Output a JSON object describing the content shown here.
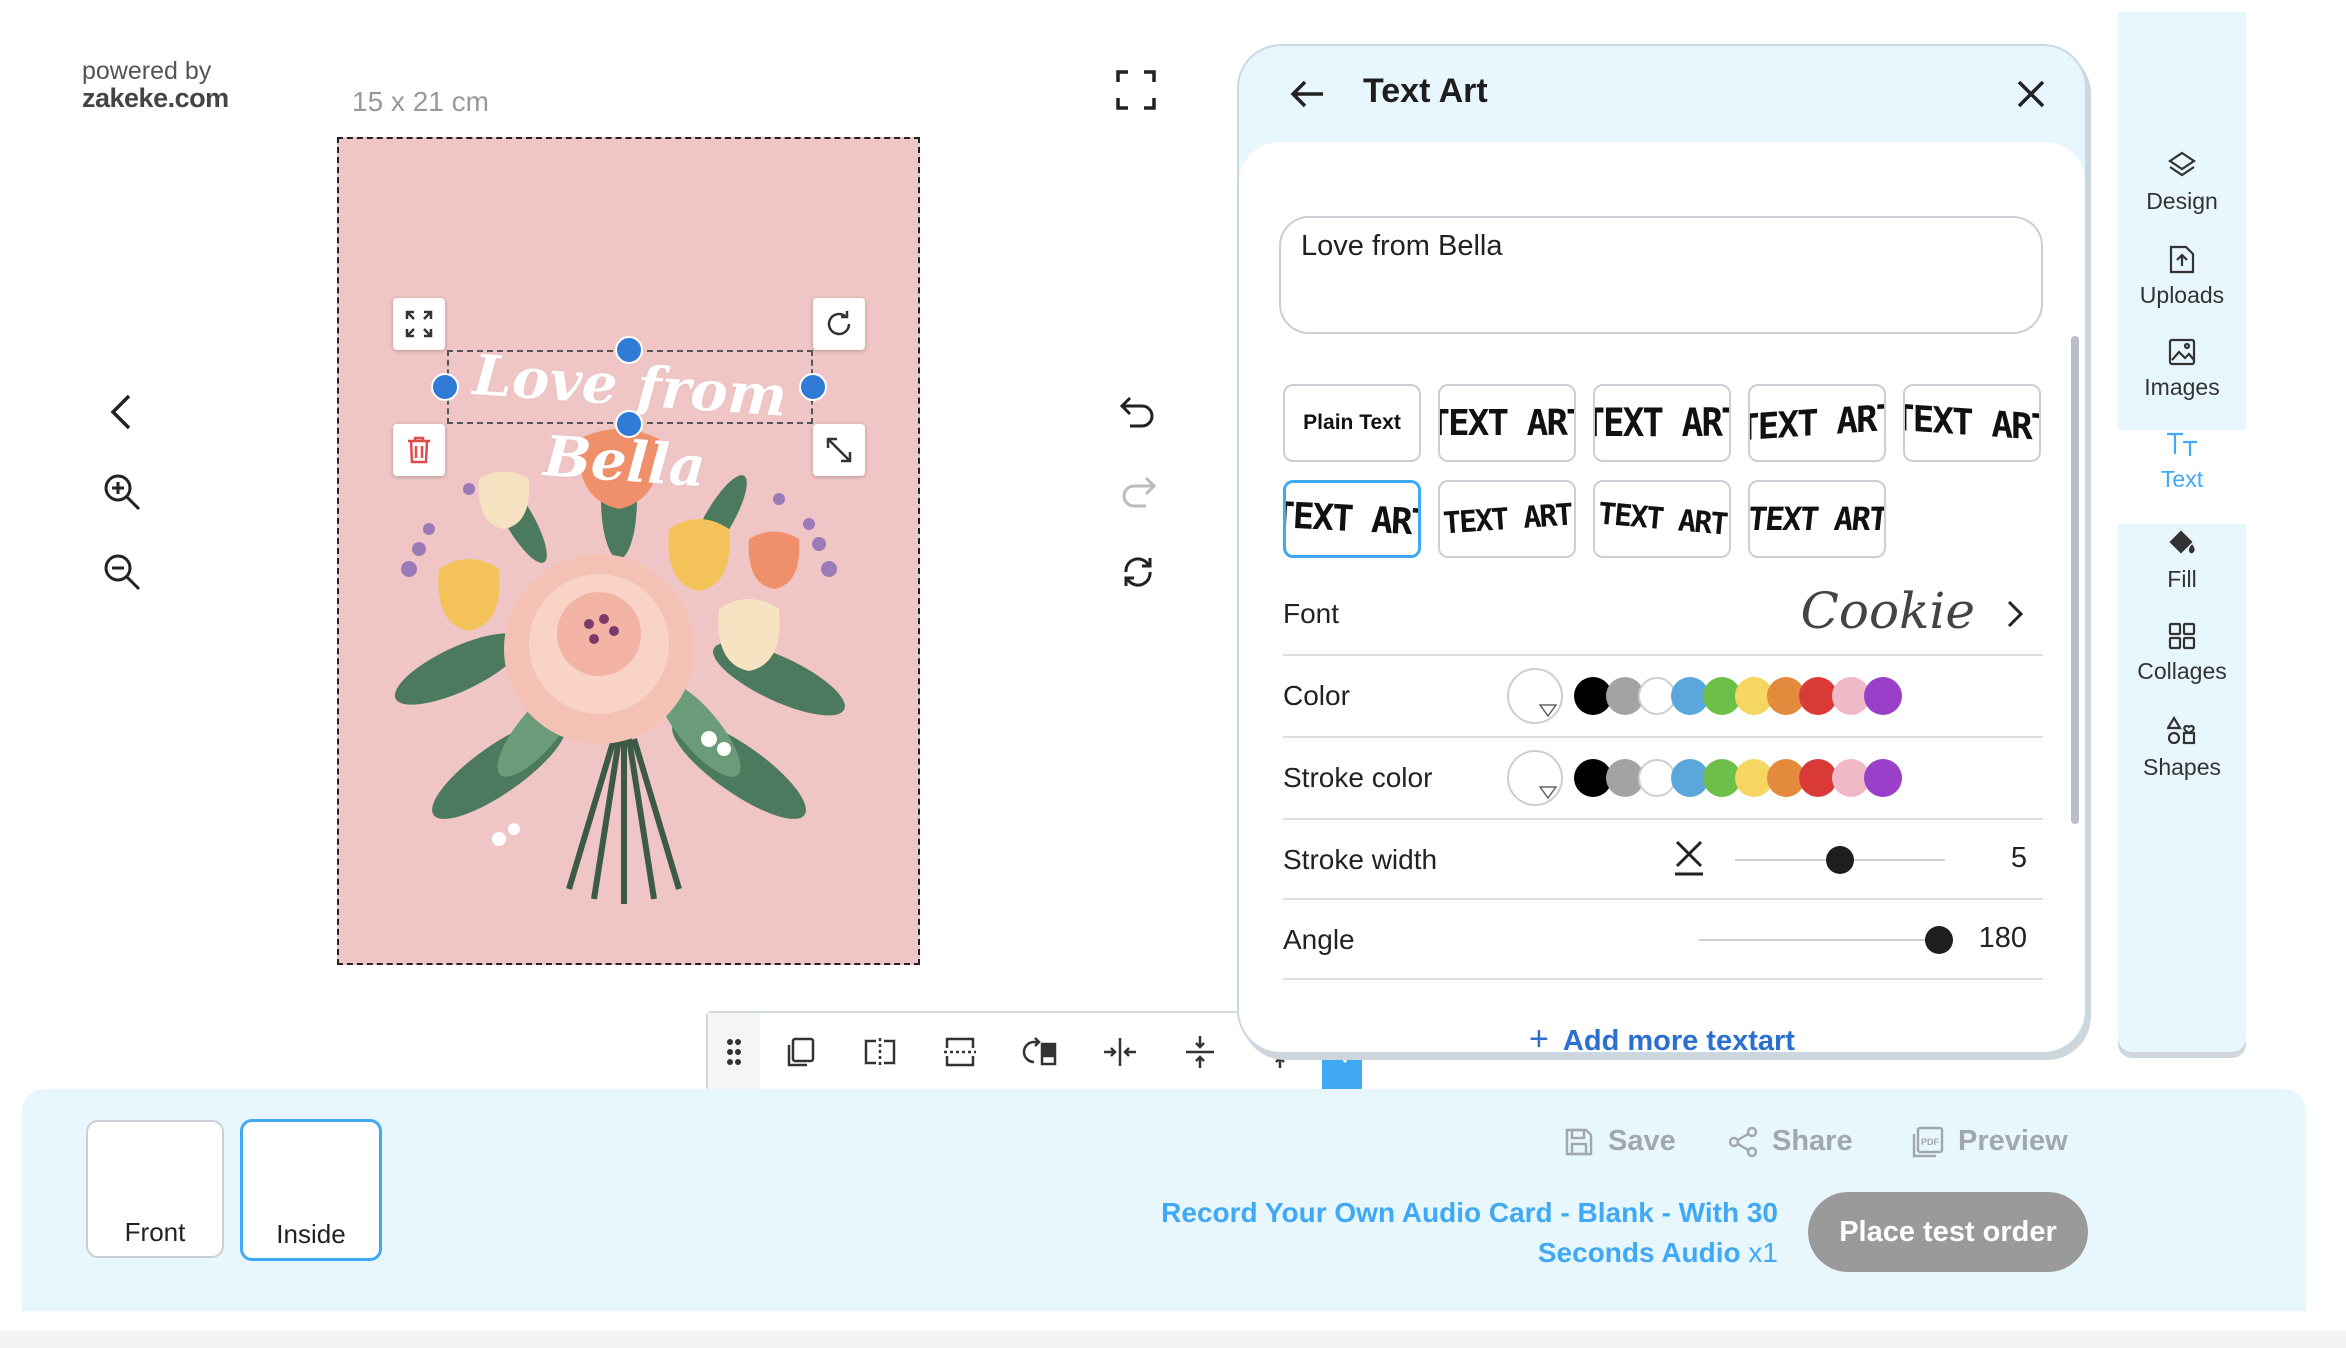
{
  "branding": {
    "powered_by": "powered by",
    "site": "zakeke.com"
  },
  "canvas": {
    "size_label": "15 x 21 cm",
    "text": "Love from Bella"
  },
  "panel": {
    "title": "Text Art",
    "text_value": "Love from Bella",
    "styles": [
      {
        "label": "Plain Text"
      },
      {
        "label": "TEXT ART"
      },
      {
        "label": "TEXT ART"
      },
      {
        "label": "TEXT ART"
      },
      {
        "label": "TEXT ART"
      },
      {
        "label": "TEXT ART"
      },
      {
        "label": "TEXT ART"
      },
      {
        "label": "TEXT ART"
      },
      {
        "label": "TEXT ART"
      }
    ],
    "selected_style_index": 5,
    "font_label": "Font",
    "font_value": "Cookie",
    "color_label": "Color",
    "stroke_color_label": "Stroke color",
    "stroke_width_label": "Stroke width",
    "stroke_width_value": "5",
    "stroke_width_fraction": 0.5,
    "angle_label": "Angle",
    "angle_value": "180",
    "angle_fraction": 1.0,
    "add_more_label": "Add more textart",
    "swatches": [
      "#000000",
      "#a3a3a3",
      "#ffffff",
      "#5ba7dc",
      "#6cc04a",
      "#f5d660",
      "#e38a3c",
      "#d93a38",
      "#f1b8c8",
      "#9a3fc9"
    ]
  },
  "sidebar": {
    "items": [
      {
        "label": "Design",
        "icon": "layers-icon"
      },
      {
        "label": "Uploads",
        "icon": "upload-icon"
      },
      {
        "label": "Images",
        "icon": "image-icon"
      },
      {
        "label": "Text",
        "icon": "text-icon"
      },
      {
        "label": "Fill",
        "icon": "paint-bucket-icon"
      },
      {
        "label": "Collages",
        "icon": "grid-icon"
      },
      {
        "label": "Shapes",
        "icon": "shapes-icon"
      }
    ],
    "active_index": 3
  },
  "bottom": {
    "sides": [
      {
        "label": "Front"
      },
      {
        "label": "Inside"
      }
    ],
    "selected_side_index": 1,
    "save_label": "Save",
    "share_label": "Share",
    "preview_label": "Preview",
    "product_name": "Record Your Own Audio Card - Blank - With 30 Seconds Audio",
    "quantity": "x1",
    "place_order_label": "Place test order"
  },
  "colors": {
    "accent": "#3fa9f5",
    "link": "#2b6fcf",
    "panel_bg": "#e8f6fd",
    "canvas_bg": "#f0c5c5",
    "handle": "#2f7bd6"
  }
}
